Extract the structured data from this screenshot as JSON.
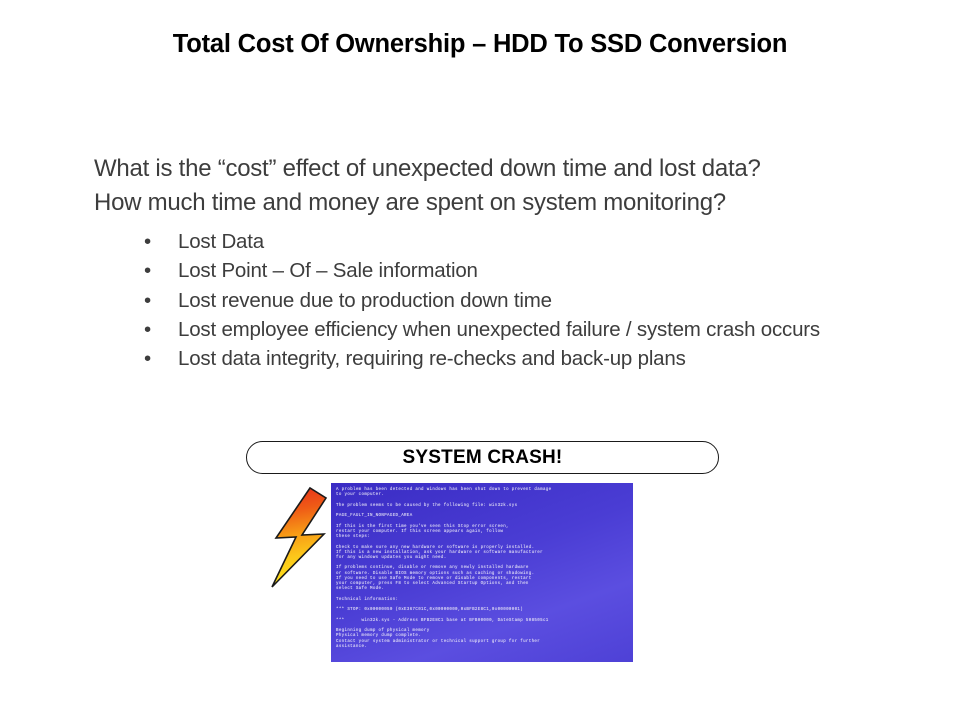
{
  "slide": {
    "title": "Total Cost Of Ownership – HDD To SSD Conversion",
    "lead_lines": [
      "What is the “cost” effect of unexpected down time and lost data?",
      "How much time and money are spent on system monitoring?"
    ],
    "bullet_marker": "•",
    "bullets": [
      "Lost Data",
      "Lost Point – Of – Sale information",
      "Lost revenue due to production down time",
      "Lost employee efficiency when unexpected failure / system crash occurs",
      "Lost data integrity, requiring re-checks and back-up plans"
    ],
    "crash_callout": "SYSTEM CRASH!",
    "colors": {
      "title_text": "#000000",
      "body_text": "#3d3d3d",
      "background": "#ffffff",
      "callout_border": "#1a1a1a",
      "bsod_background": "#3e30c9",
      "bsod_text": "#e6e3f7",
      "bolt_top": "#e8341a",
      "bolt_mid": "#f79a16",
      "bolt_bottom": "#ffe81a",
      "bolt_outline": "#1a1a1a"
    }
  },
  "bsod": {
    "paragraphs": [
      "A problem has been detected and windows has been shut down to prevent damage\nto your computer.",
      "The problem seems to be caused by the following file: win32k.sys",
      "PAGE_FAULT_IN_NONPAGED_AREA",
      "If this is the first time you've seen this Stop error screen,\nrestart your computer. If this screen appears again, follow\nthese steps:",
      "Check to make sure any new hardware or software is properly installed.\nIf this is a new installation, ask your hardware or software manufacturer\nfor any windows updates you might need.",
      "If problems continue, disable or remove any newly installed hardware\nor software. Disable BIOS memory options such as caching or shadowing.\nIf you need to use Safe Mode to remove or disable components, restart\nyour computer, press F8 to select Advanced Startup Options, and then\nselect Safe Mode.",
      "Technical information:",
      "*** STOP: 0x00000050 (0xE367C01C,0x00000000,0xBFB2E8C1,0x00000001)",
      "***      win32k.sys - Address BFB2E8C1 base at BFB00000, DateStamp 508505c1",
      "Beginning dump of physical memory\nPhysical memory dump complete.\nContact your system administrator or technical support group for further\nassistance."
    ]
  },
  "icons": {
    "lightning_bolt": "lightning-bolt-icon"
  }
}
